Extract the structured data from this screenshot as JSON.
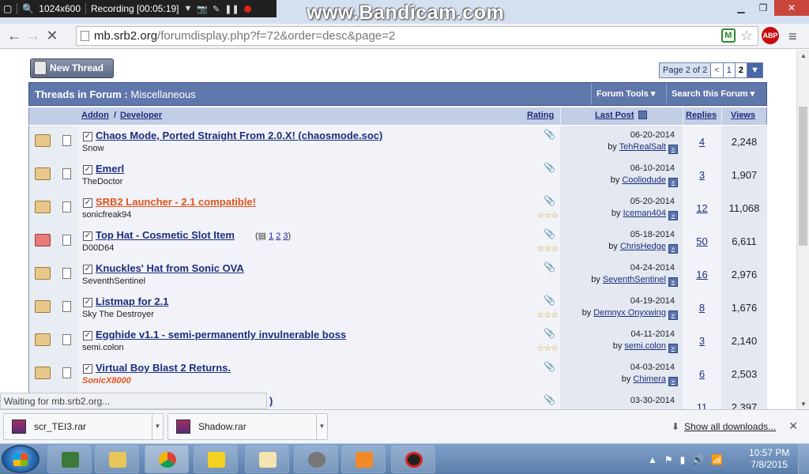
{
  "recorder": {
    "resolution": "1024x600",
    "status": "Recording [00:05:19]",
    "watermark": "www.Bandicam.com"
  },
  "browser": {
    "url_host": "mb.srb2.org",
    "url_path": "/forumdisplay.php?f=72&order=desc&page=2",
    "abp_label": "ABP",
    "status_text": "Waiting for mb.srb2.org..."
  },
  "forum": {
    "new_thread_label": "New Thread",
    "pager": {
      "label": "Page 2 of 2",
      "prev": "<",
      "p1": "1",
      "p2": "2"
    },
    "header_title": "Threads in Forum :",
    "header_forum": "Miscellaneous",
    "forum_tools": "Forum Tools",
    "search_forum": "Search this Forum",
    "columns": {
      "addon": "Addon",
      "slash": "/",
      "developer": "Developer",
      "rating": "Rating",
      "last_post": "Last Post",
      "replies": "Replies",
      "views": "Views"
    },
    "threads": [
      {
        "title": "Chaos Mode, Ported Straight From 2.0.X! (chaosmode.soc)",
        "author": "Snow",
        "date": "06-20-2014",
        "by": "TehRealSalt",
        "replies": "4",
        "views": "2,248"
      },
      {
        "title": "Emerl",
        "author": "TheDoctor",
        "date": "06-10-2014",
        "by": "Cooliodude",
        "replies": "3",
        "views": "1,907"
      },
      {
        "title": "SRB2 Launcher - 2.1 compatible!",
        "author": "sonicfreak94",
        "date": "05-20-2014",
        "by": "Iceman404",
        "replies": "12",
        "views": "11,068",
        "stars": "☆☆☆"
      },
      {
        "title": "Top Hat - Cosmetic Slot Item",
        "author": "D00D64",
        "date": "05-18-2014",
        "by": "ChrisHedge",
        "replies": "50",
        "views": "6,611",
        "stars": "☆☆☆",
        "pages": [
          "1",
          "2",
          "3"
        ]
      },
      {
        "title": "Knuckles' Hat from Sonic OVA",
        "author": "SeventhSentinel",
        "date": "04-24-2014",
        "by": "SeventhSentinel",
        "replies": "16",
        "views": "2,976"
      },
      {
        "title": "Listmap for 2.1",
        "author": "Sky The Destroyer",
        "date": "04-19-2014",
        "by": "Demnyx Onyxwing",
        "replies": "8",
        "views": "1,676",
        "stars": "☆☆☆"
      },
      {
        "title": "Egghide v1.1 - semi-permanently invulnerable boss",
        "author": "semi.colon",
        "date": "04-11-2014",
        "by": "semi.colon",
        "replies": "3",
        "views": "2,140",
        "stars": "☆☆☆"
      },
      {
        "title": "Virtual Boy Blast 2 Returns.",
        "author": "SonicX8000",
        "date": "04-03-2014",
        "by": "Chimera",
        "replies": "6",
        "views": "2,503"
      },
      {
        "title": ")",
        "author": "",
        "date": "03-30-2014",
        "by": "",
        "replies": "11",
        "views": "2,397"
      }
    ]
  },
  "downloads": {
    "items": [
      "scr_TEI3.rar",
      "Shadow.rar"
    ],
    "show_all": "Show all downloads..."
  },
  "taskbar": {
    "time": "10:57 PM",
    "date": "7/8/2015"
  }
}
